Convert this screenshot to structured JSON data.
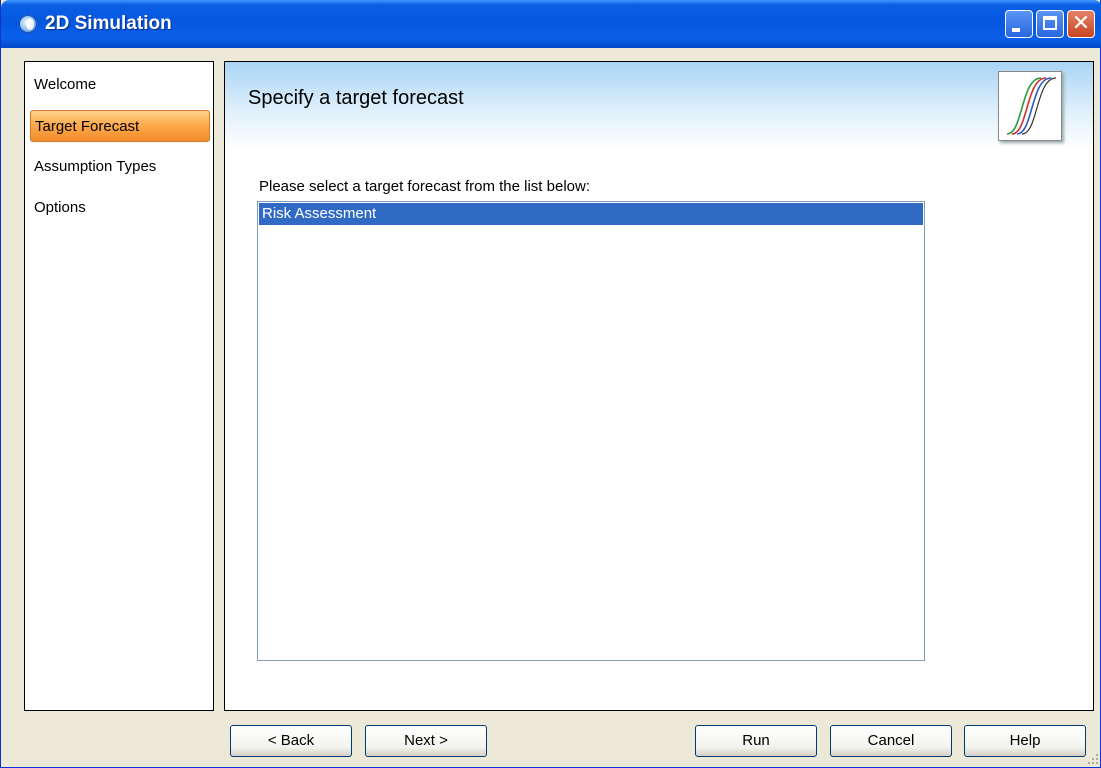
{
  "window": {
    "title": "2D Simulation"
  },
  "title_controls": {
    "close_glyph": "✕"
  },
  "sidebar": {
    "items": [
      {
        "label": "Welcome",
        "active": false
      },
      {
        "label": "Target Forecast",
        "active": true
      },
      {
        "label": "Assumption Types",
        "active": false
      },
      {
        "label": "Options",
        "active": false
      }
    ]
  },
  "main": {
    "header_title": "Specify a target forecast",
    "logo_icon": "s-curves-icon",
    "prompt": "Please select a target forecast from the list below:",
    "forecasts": [
      {
        "label": "Risk Assessment",
        "selected": true
      }
    ]
  },
  "buttons": {
    "back": "< Back",
    "next": "Next >",
    "run": "Run",
    "cancel": "Cancel",
    "help": "Help"
  },
  "colors": {
    "title_bar": "#0557e0",
    "nav_active": "#fca84a",
    "selection": "#316ac5"
  }
}
